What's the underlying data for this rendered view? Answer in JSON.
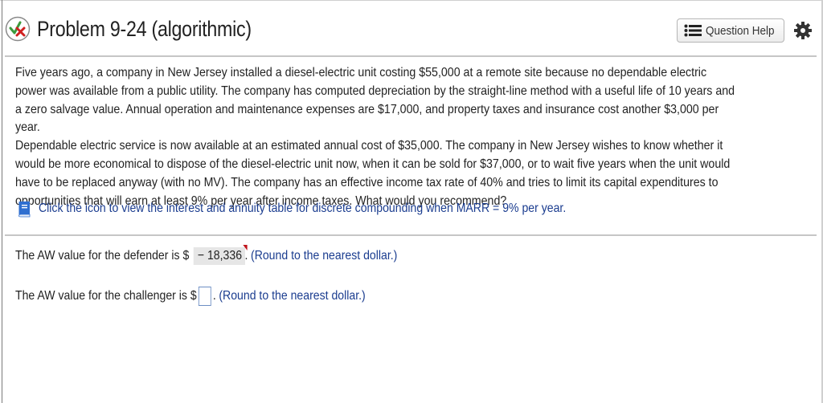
{
  "header": {
    "title": "Problem 9-24 (algorithmic)",
    "status_icon": "partially-correct-icon",
    "help_button_label": "Question Help",
    "help_button_icon": "list-icon",
    "settings_icon": "gear-icon"
  },
  "problem": {
    "paragraph_1": "Five years ago, a company in New Jersey installed a diesel-electric unit costing $55,000 at a remote site because no dependable electric power was available from a public utility. The company has computed depreciation by the straight-line method with a useful life of 10 years and a zero salvage value. Annual operation and maintenance expenses are $17,000, and property taxes and insurance cost another $3,000 per year.",
    "paragraph_2": "Dependable electric service is now available at an estimated annual cost of $35,000. The company in New Jersey wishes to know whether it would be more economical to dispose of the diesel-electric unit now, when it can be sold for $37,000, or to wait five years when the unit would have to be replaced anyway (with no MV). The company has an effective income tax rate of 40% and tries to limit its capital expenditures to opportunities that will earn at least 9% per year after income taxes. What would you recommend?"
  },
  "resource": {
    "icon": "book-icon",
    "link_text": "Click the icon to view the interest and annuity table for discrete compounding when MARR = 9% per year."
  },
  "answers": [
    {
      "prefix": "The AW value for the defender is $",
      "value": "− 18,336",
      "suffix": ".",
      "note": "(Round to the nearest dollar.)",
      "status": "incorrect"
    },
    {
      "prefix": "The AW value for the challenger is $",
      "value": "",
      "suffix": ".",
      "note": "(Round to the nearest dollar.)"
    }
  ],
  "colors": {
    "link_blue": "#1a3c8f",
    "incorrect_flag": "#c0141c",
    "input_border": "#6d8ec4",
    "answer_bg": "#e6e6e6"
  }
}
